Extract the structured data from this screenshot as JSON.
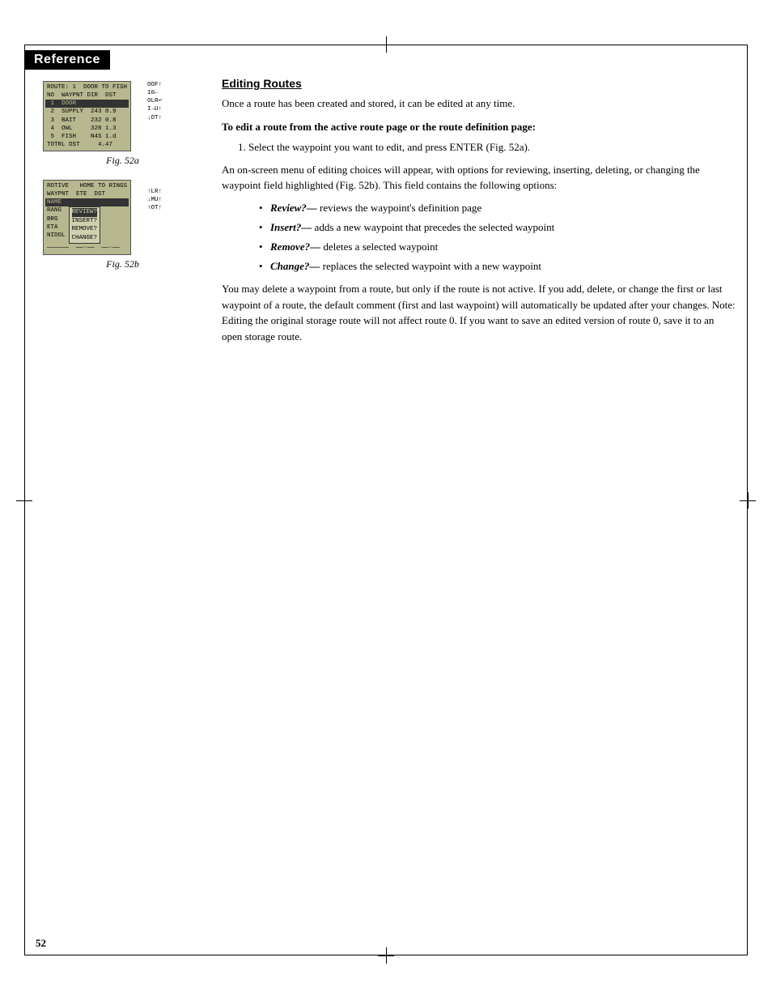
{
  "page": {
    "number": "52",
    "header": "Reference"
  },
  "section": {
    "title": "Editing Routes",
    "intro": "Once a route has been created and stored, it can be edited at any time.",
    "bold_instruction": "To edit a route from the active route page or the route definition page:",
    "step1": "1. Select the waypoint you want to edit, and press ENTER (Fig. 52a).",
    "body1": "An on-screen menu of editing choices will appear, with options for reviewing, inserting, deleting, or changing the waypoint field highlighted (Fig. 52b). This field contains the following options:",
    "bullets": [
      {
        "term": "Review?—",
        "desc": "reviews the waypoint's definition page"
      },
      {
        "term": "Insert?—",
        "desc": "adds a new waypoint that precedes the selected waypoint"
      },
      {
        "term": "Remove?—",
        "desc": "deletes a selected waypoint"
      },
      {
        "term": "Change?—",
        "desc": "replaces the selected waypoint with a new waypoint"
      }
    ],
    "body2": "You may delete a waypoint from a route, but only if the route is not active. If you add, delete, or change the first or last waypoint of a route, the default comment (first and last waypoint) will automatically be updated after your changes. Note: Editing the original storage route will not affect route 0. If you want to save an edited version of route 0, save it to an open storage route."
  },
  "fig52a": {
    "label": "Fig. 52a",
    "lines": [
      "ROUTE: 1  DOOR TO FISH",
      "NO  WAYPNT DIR  DST",
      "1  DOOR",
      "2  SUPPLY  243 0.9",
      "3  BAIT    232 0.8",
      "4  OWL     328 1.3",
      "5  FISH    N4S 1.d",
      "TOTRL DST     4.47"
    ]
  },
  "fig52b": {
    "label": "Fig. 52b",
    "lines": [
      "ROTIVE   HOME TO RINGS",
      "WAYPNT  ETE  DST",
      "NAME",
      "RANG",
      "BRG",
      "ETA",
      "NIDOL"
    ],
    "menu_items": [
      "REVIEW?",
      "INSERT?",
      "REMOVE?",
      "CHANGE?"
    ]
  }
}
